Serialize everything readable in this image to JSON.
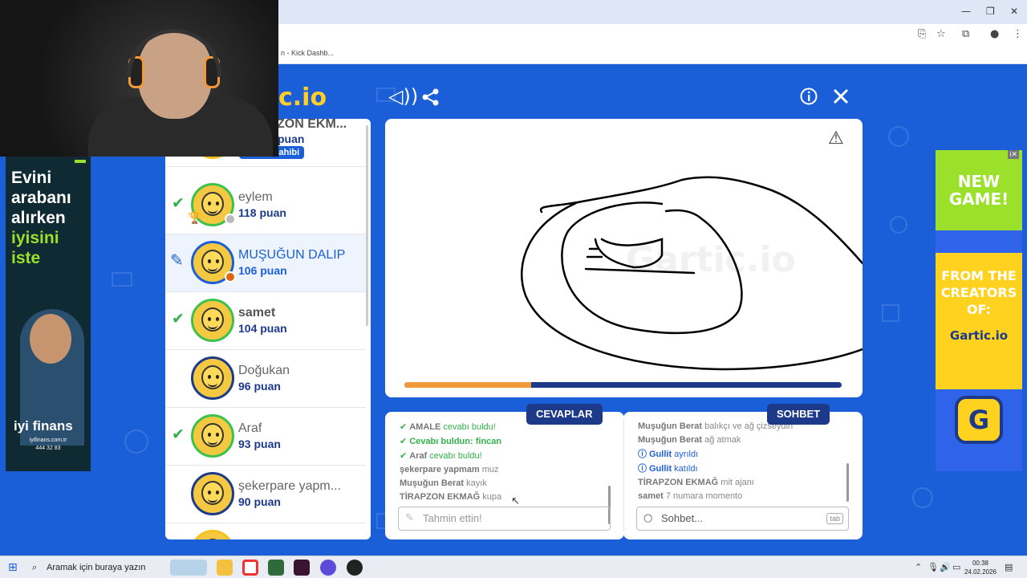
{
  "browser": {
    "tab_bookmark": "n - Kick Dashb...",
    "window_controls": {
      "minimize": "—",
      "restore": "❐",
      "close": "✕"
    }
  },
  "game": {
    "logo": "c.io",
    "icons": {
      "sound": "speaker-icon",
      "share": "share-icon",
      "info": "info-icon",
      "close": "close-icon",
      "report": "warning-icon"
    }
  },
  "players": [
    {
      "name": "TİRAPZON EKM...",
      "score": "puan",
      "badge": "Oda Sahibi",
      "status_color": "#f5c21b"
    },
    {
      "name": "eylem",
      "score": "118 puan",
      "guessed": true,
      "trophy": true,
      "status_color": "#bbbbbb"
    },
    {
      "name": "MUŞUĞUN DALIP",
      "score": "106 puan",
      "drawing": true,
      "status_color": "#e0650e"
    },
    {
      "name": "samet",
      "score": "104 puan",
      "guessed": true
    },
    {
      "name": "Doğukan",
      "score": "96 puan",
      "guessed": false
    },
    {
      "name": "Araf",
      "score": "93 puan",
      "guessed": true
    },
    {
      "name": "şekerpare yapm...",
      "score": "90 puan",
      "guessed": false
    }
  ],
  "board": {
    "timer_progress": 0.29
  },
  "answers": {
    "title": "CEVAPLAR",
    "messages": [
      {
        "type": "green",
        "name": "AMALE",
        "text": " cevabı buldu!"
      },
      {
        "type": "green",
        "name": "",
        "text": "Cevabı buldun: fincan"
      },
      {
        "type": "green",
        "name": "Araf",
        "text": " cevabı buldu!"
      },
      {
        "type": "normal",
        "name": "şekerpare yapmam",
        "text": " muz"
      },
      {
        "type": "normal",
        "name": "Muşuğun Berat",
        "text": " kayık"
      },
      {
        "type": "normal",
        "name": "TİRAPZON EKMAĞ",
        "text": " kupa"
      }
    ],
    "placeholder": "Tahmin ettin!"
  },
  "chat": {
    "title": "SOHBET",
    "messages": [
      {
        "type": "normal",
        "name": "Muşuğun Berat",
        "text": " balıkçı ve ağ çizseydin"
      },
      {
        "type": "normal",
        "name": "Muşuğun Berat",
        "text": " ağ atmak"
      },
      {
        "type": "info",
        "name": "Gullit",
        "text": " ayrıldı"
      },
      {
        "type": "info",
        "name": "Gullit",
        "text": " katıldı"
      },
      {
        "type": "normal",
        "name": "TİRAPZON EKMAĞ",
        "text": " mit ajanı"
      },
      {
        "type": "normal",
        "name": "samet",
        "text": " 7 numara momento"
      }
    ],
    "placeholder": "Sohbet...",
    "tab_hint": "tab"
  },
  "ad_left": {
    "line1": "Evini",
    "line2": "arabanı",
    "line3": "alırken",
    "line4": "iyisini",
    "line5": "iste",
    "brand": "iyi finans",
    "url": "iyifinans.com.tr",
    "phone": "444 32 83"
  },
  "ad_right": {
    "line1": "NEW",
    "line2": "GAME!",
    "line3": "FROM THE",
    "line4": "CREATORS",
    "line5": "OF:",
    "logo": "Gartic.io",
    "app_letter": "G"
  },
  "taskbar": {
    "search_placeholder": "Aramak için buraya yazın",
    "time": "00:38",
    "date": "24.02.2026"
  }
}
